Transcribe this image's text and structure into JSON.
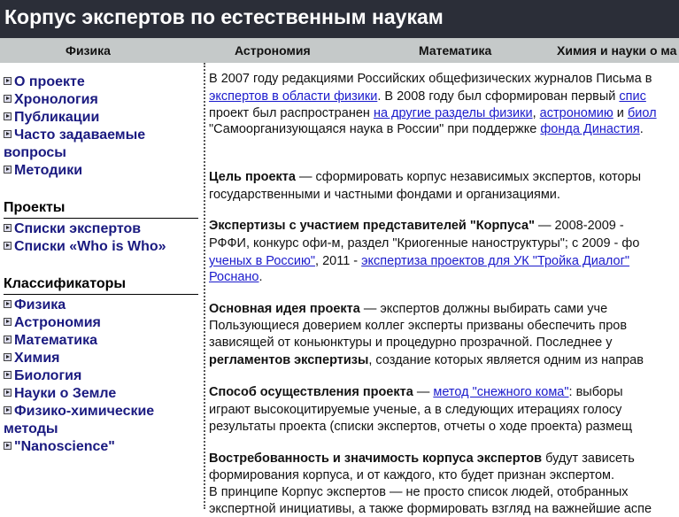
{
  "header": {
    "title": "Корпус экспертов по естественным наукам"
  },
  "nav": {
    "tabs": [
      "Физика",
      "Астрономия",
      "Математика",
      "Химия и науки о ма"
    ]
  },
  "sidebar": {
    "top_items": [
      "О проекте",
      "Хронология",
      "Публикации",
      "Часто задаваемые",
      "вопросы",
      "Методики"
    ],
    "projects_heading": "Проекты",
    "projects": [
      "Списки экспертов",
      "Списки  «Who is Who»"
    ],
    "classifiers_heading": "Классификаторы",
    "classifiers": [
      "Физика",
      "Астрономия",
      "Математика",
      "Химия",
      "Биология",
      "Науки о Земле",
      "Физико-химические",
      "методы",
      "\"Nanoscience\""
    ]
  },
  "content": {
    "p1_l1": "В 2007 году редакциями Российских общефизических журналов Письма в",
    "p1_l2_link": "экспертов в области физики",
    "p1_l2_text": ". В 2008 году был сформирован первый ",
    "p1_l2_link2": "спис",
    "p1_l3_text": "проект был распространен ",
    "p1_l3_link1": "на другие разделы физики",
    "p1_l3_comma": ", ",
    "p1_l3_link2": "астрономию",
    "p1_l3_and": " и ",
    "p1_l3_link3": "биол",
    "p1_l4_text": " \"Самоорганизующаяся наука в России\" при поддержке ",
    "p1_l4_link": "фонда Династия",
    "p1_l4_end": ".",
    "p2_bold": "Цель проекта",
    "p2_l1": " — сформировать корпус независимых экспертов, которы",
    "p2_l2": "государственными и частными фондами и организациями.",
    "p3_bold": "Экспертизы с участием представителей \"Корпуса\"",
    "p3_l1": " — 2008-2009 -",
    "p3_l2": "РФФИ, конкурс офи-м, раздел \"Криогенные наноструктуры\"; с 2009 - фо",
    "p3_l3_link1": "ученых в Россию\"",
    "p3_l3_text": ", 2011 - ",
    "p3_l3_link2": "экспертиза проектов для УК \"Тройка Диалог\"",
    "p3_l4_link": "Роснано",
    "p3_l4_end": ".",
    "p4_bold": "Основная идея проекта",
    "p4_l1": " — экспертов должны выбирать сами уче",
    "p4_l2": "Пользующиеся доверием коллег эксперты призваны обеспечить пров",
    "p4_l3": "зависящей от коньюнктуры и  процедурно прозрачной. Последнее у",
    "p4_l4_bold": "регламентов экспертизы",
    "p4_l4": ", создание которых является одним из направ",
    "p5_bold": "Способ осуществления проекта",
    "p5_l1a": " — ",
    "p5_link": "метод \"снежного кома\"",
    "p5_l1b": ": выборы",
    "p5_l2": "играют высокоцитируемые ученые, а в следующих итерациях голосу",
    "p5_l3": "результаты проекта (списки экспертов, отчеты о ходе проекта) размещ",
    "p6_bold": "Востребованность и значимость корпуса экспертов",
    "p6_l1": " будут зависеть",
    "p6_l2": "формирования корпуса, и от каждого, кто будет признан экспертом.",
    "p6_l3": "В принципе Корпус экспертов — не просто список людей, отобранных",
    "p6_l4": "экспертной инициативы, а также формировать взгляд на важнейшие аспе"
  }
}
